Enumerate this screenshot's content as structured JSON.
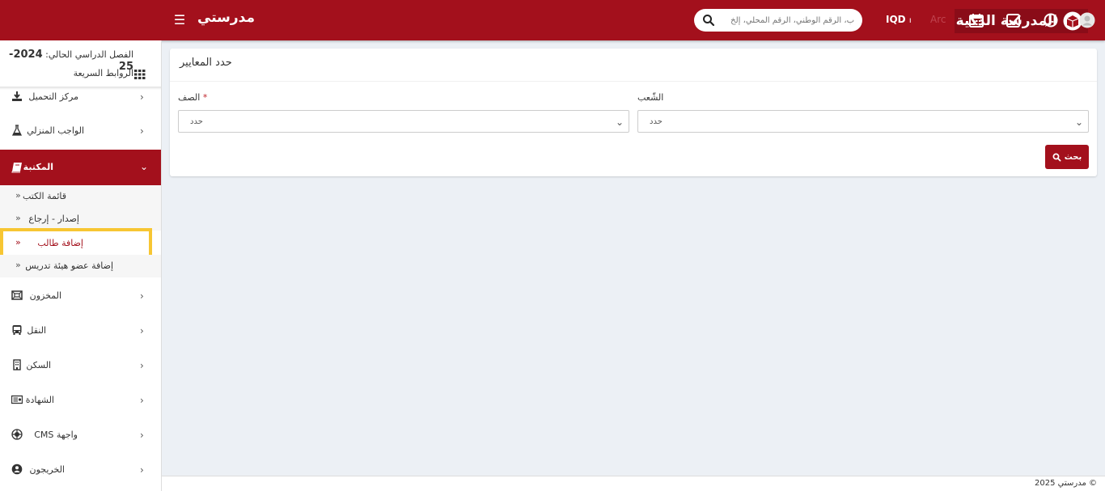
{
  "header": {
    "logo_text": "المدرسة الذكية",
    "app_title": "مدرستي",
    "menu_icon": "hamburger-icon",
    "search_placeholder": "ب، الرقم الوطني، الرقم المحلي، إلخ",
    "currency": "IQD",
    "language": "Arc",
    "icons": [
      "calendar-icon",
      "checklist-icon",
      "whatsapp-icon",
      "user-avatar-icon"
    ]
  },
  "sidebar": {
    "semester_label": "الفصل الدراسي الحالي:",
    "semester_value": "2024-25",
    "quick_links": "الروابط السريعة",
    "items": [
      {
        "label": "مركز التحميل",
        "icon": "download-icon"
      },
      {
        "label": "الواجب المنزلي",
        "icon": "flask-icon"
      },
      {
        "label": "المكتبة",
        "icon": "book-icon"
      },
      {
        "label": "المخزون",
        "icon": "inventory-icon"
      },
      {
        "label": "النقل",
        "icon": "bus-icon"
      },
      {
        "label": "السكن",
        "icon": "building-icon"
      },
      {
        "label": "الشهادة",
        "icon": "certificate-icon"
      },
      {
        "label": "واجهة CMS",
        "icon": "cms-icon"
      },
      {
        "label": "الخريجون",
        "icon": "alumni-icon"
      }
    ],
    "library_sub": [
      {
        "label": "قائمة الكتب"
      },
      {
        "label": "إصدار - إرجاع"
      },
      {
        "label": "إضافة طالب"
      },
      {
        "label": "إضافة عضو هيئة تدريس"
      }
    ]
  },
  "main": {
    "panel_title": "حدد المعايير",
    "class_label": "الصف",
    "section_label": "الشّعب",
    "class_value": "حدد",
    "section_value": "حدد",
    "search_button": "بحث"
  },
  "footer": {
    "text": "مدرستي 2025 ©"
  },
  "colors": {
    "brand": "#a3101c",
    "highlight": "#f7c633"
  }
}
